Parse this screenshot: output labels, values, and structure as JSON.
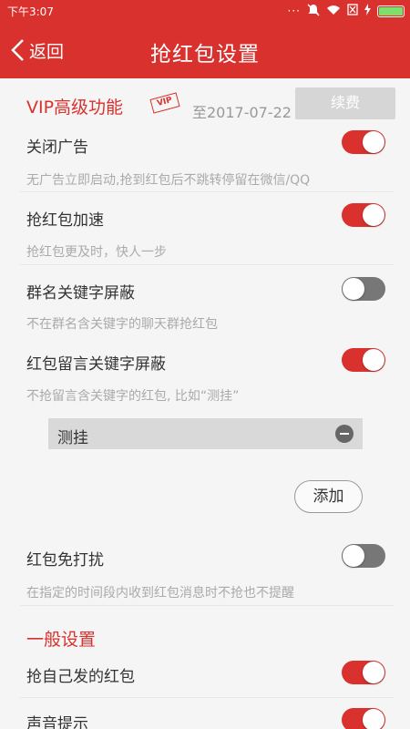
{
  "status_bar": {
    "time": "下午3:07",
    "dots": "···"
  },
  "app_bar": {
    "back_label": "返回",
    "title": "抢红包设置"
  },
  "vip": {
    "title": "VIP高级功能",
    "stamp": "VIP",
    "expire": "至2017-07-22",
    "renew_label": "续费"
  },
  "settings": [
    {
      "label": "关闭广告",
      "desc": "无广告立即启动,抢到红包后不跳转停留在微信/QQ",
      "on": true
    },
    {
      "label": "抢红包加速",
      "desc": "抢红包更及时，快人一步",
      "on": true
    },
    {
      "label": "群名关键字屏蔽",
      "desc": "不在群名含关键字的聊天群抢红包",
      "on": false
    },
    {
      "label": "红包留言关键字屏蔽",
      "desc": "不抢留言含关键字的红包, 比如“测挂”",
      "on": true
    }
  ],
  "keywords": [
    "测挂"
  ],
  "add_label": "添加",
  "dnd": {
    "label": "红包免打扰",
    "desc": "在指定的时间段内收到红包消息时不抢也不提醒",
    "on": false
  },
  "general": {
    "title": "一般设置",
    "items": [
      {
        "label": "抢自己发的红包",
        "on": true
      },
      {
        "label": "声音提示",
        "on": true
      }
    ]
  },
  "colors": {
    "accent": "#d9312e",
    "switch_off": "#777777",
    "battery": "#7ee06a"
  }
}
